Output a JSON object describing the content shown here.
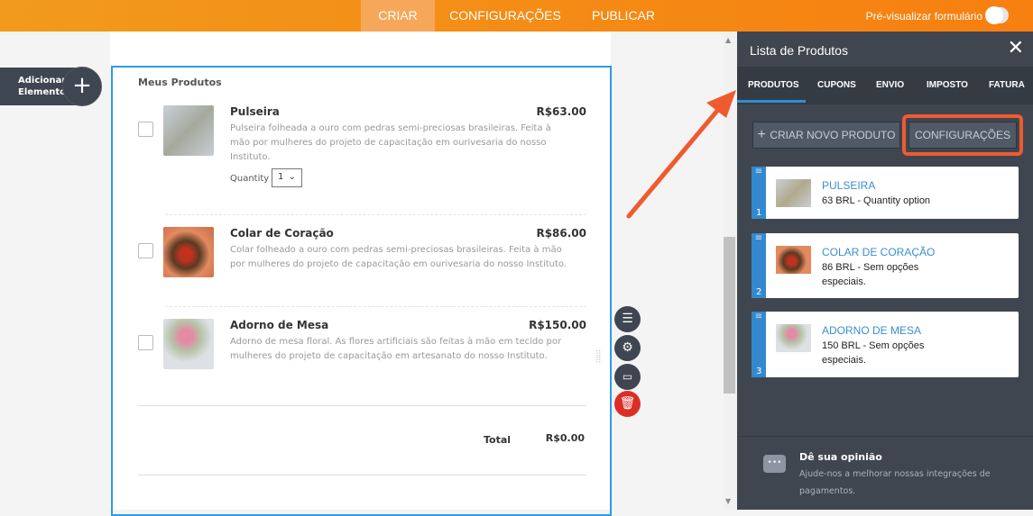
{
  "topbar": {
    "tabs": [
      {
        "label": "CRIAR"
      },
      {
        "label": "CONFIGURAÇÕES"
      },
      {
        "label": "PUBLICAR"
      }
    ],
    "preview_label": "Pré-visualizar formulário"
  },
  "add_element": {
    "label": "Adicionar Elemento",
    "icon": "plus-icon"
  },
  "form": {
    "title": "Meus Produtos",
    "products": [
      {
        "name": "Pulseira",
        "price": "R$63.00",
        "description": "Pulseira folheada a ouro com pedras semi-preciosas brasileiras. Feita à mão por mulheres do projeto de capacitação em ourivesaria do nosso Instituto.",
        "quantity_label": "Quantity",
        "quantity_value": "1"
      },
      {
        "name": "Colar de Coração",
        "price": "R$86.00",
        "description": "Colar folheado a ouro com pedras semi-preciosas brasileiras. Feita à mão por mulheres do projeto de capacitação em ourivesaria do nosso Instituto."
      },
      {
        "name": "Adorno de Mesa",
        "price": "R$150.00",
        "description": "Adorno de mesa floral. As flores artificiais são feitas à mão em tecido por mulheres do projeto de capacitação em artesanato do nosso Instituto."
      }
    ],
    "total_label": "Total",
    "total_value": "R$0.00"
  },
  "panel": {
    "title": "Lista de Produtos",
    "tabs": [
      "PRODUTOS",
      "CUPONS",
      "ENVIO",
      "IMPOSTO",
      "FATURA"
    ],
    "create_button": "CRIAR NOVO PRODUTO",
    "settings_button": "CONFIGURAÇÕES",
    "items": [
      {
        "num": "1",
        "name": "PULSEIRA",
        "desc": "63 BRL - Quantity option"
      },
      {
        "num": "2",
        "name": "COLAR DE CORAÇÃO",
        "desc": "86 BRL - Sem opções especiais."
      },
      {
        "num": "3",
        "name": "ADORNO DE MESA",
        "desc": "150 BRL - Sem opções especiais."
      }
    ],
    "feedback_title": "Dê sua opinião",
    "feedback_desc": "Ajude-nos a melhorar nossas integrações de pagamentos."
  },
  "colors": {
    "accent": "#f7820f",
    "highlight": "#ef5b2f",
    "link": "#3a8ed1",
    "panel": "#3f4650"
  }
}
